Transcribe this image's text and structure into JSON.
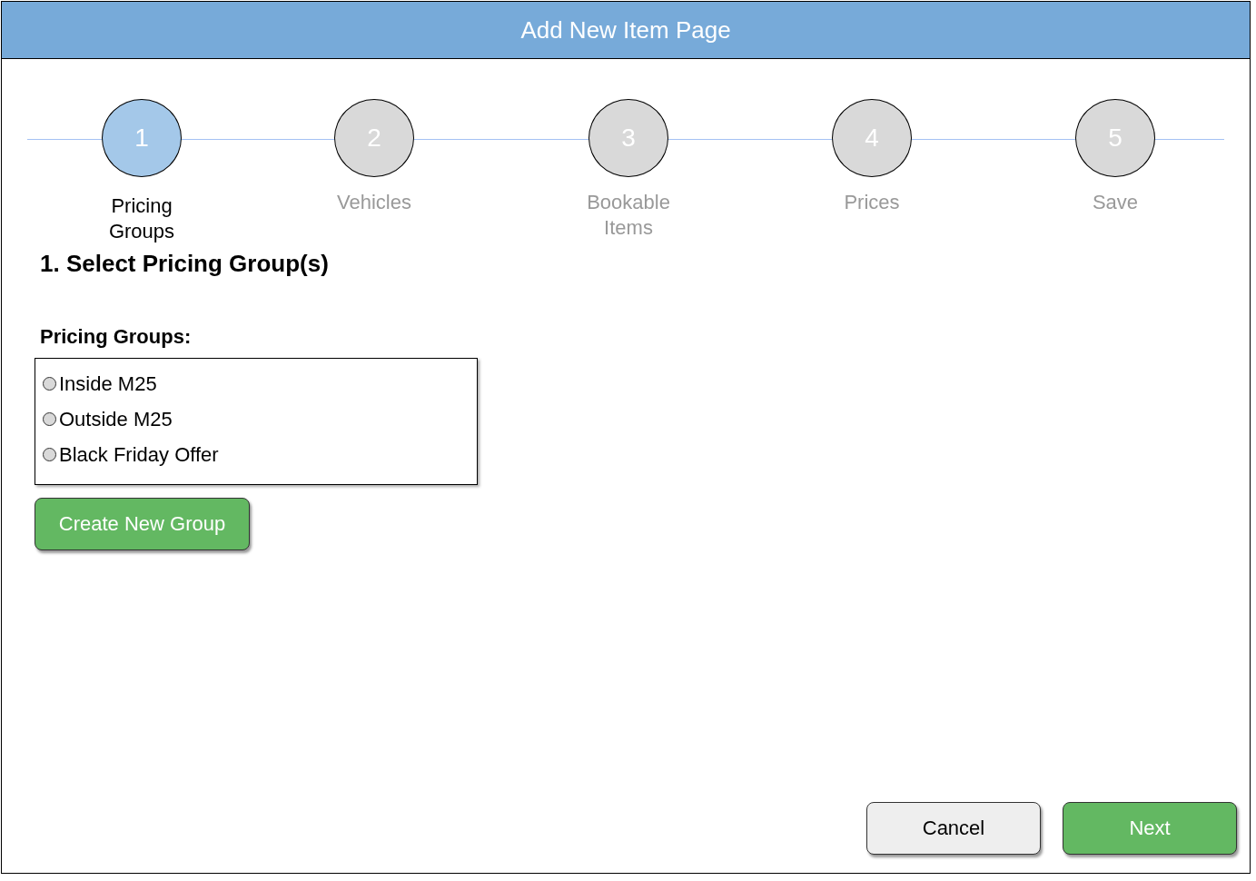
{
  "window": {
    "title": "Add New Item Page"
  },
  "steps": [
    {
      "number": "1",
      "label": "Pricing Groups",
      "selected": true
    },
    {
      "number": "2",
      "label": "Vehicles",
      "selected": false
    },
    {
      "number": "3",
      "label": "Bookable Items",
      "selected": false
    },
    {
      "number": "4",
      "label": "Prices",
      "selected": false
    },
    {
      "number": "5",
      "label": "Save",
      "selected": false
    }
  ],
  "section_heading": "1. Select Pricing Group(s)",
  "pricing_groups": {
    "label": "Pricing Groups:",
    "options": [
      {
        "label": "Inside M25",
        "selected": false
      },
      {
        "label": "Outside M25",
        "selected": false
      },
      {
        "label": "Black Friday Offer",
        "selected": false
      }
    ]
  },
  "create_button": "Create New Group",
  "buttons": [
    {
      "label": "Cancel",
      "kind": "secondary"
    },
    {
      "label": "Next",
      "kind": "primary"
    }
  ]
}
